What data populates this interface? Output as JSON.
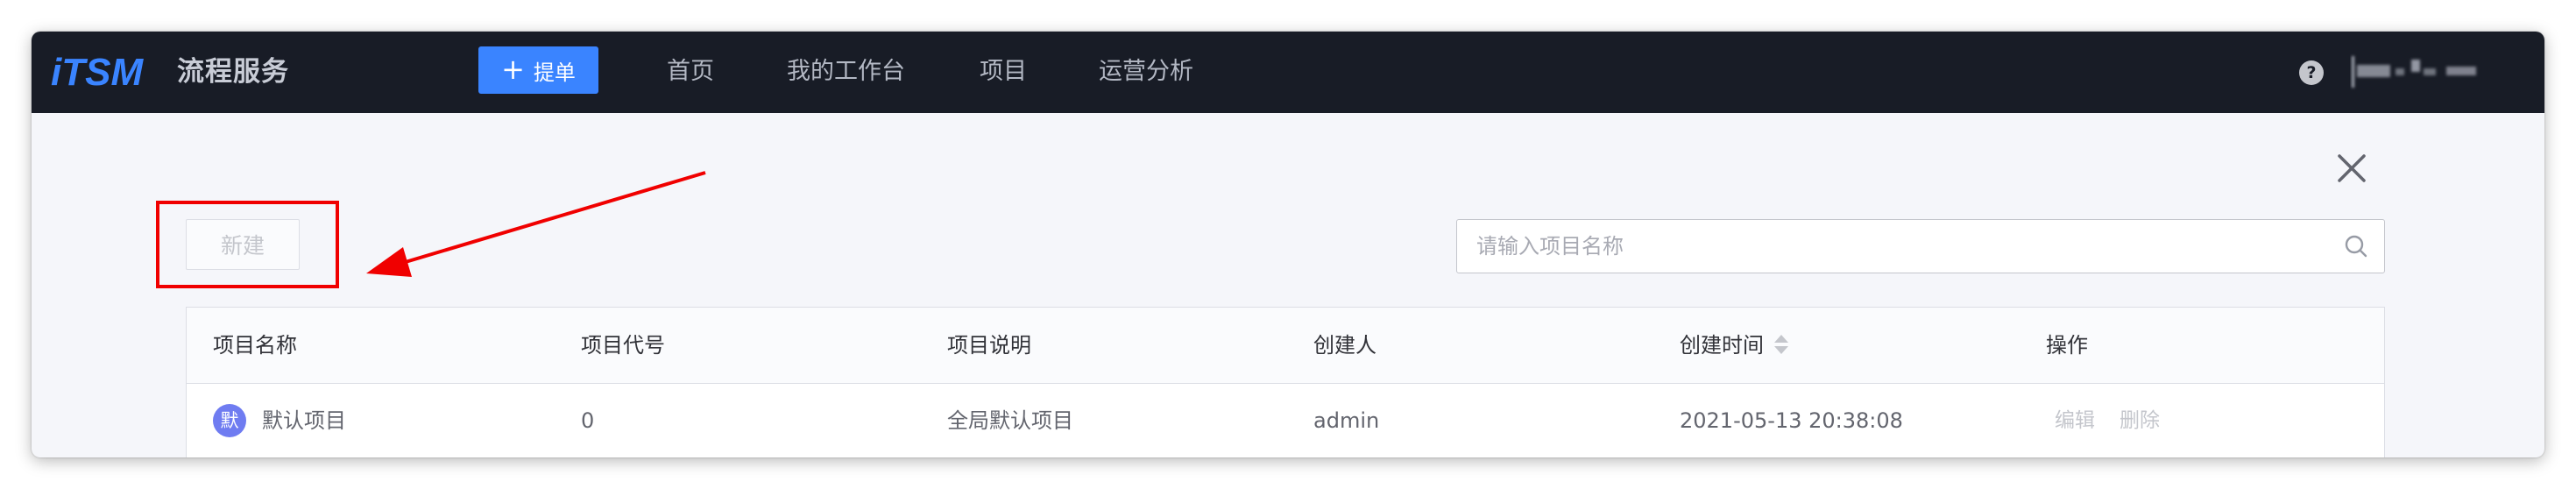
{
  "app": {
    "logo_text": "iTSM",
    "title": "流程服务",
    "submit_button": {
      "icon": "plus-icon",
      "label": "提单"
    },
    "nav": [
      "首页",
      "我的工作台",
      "项目",
      "运营分析"
    ],
    "help_icon": "question-icon",
    "help_glyph": "?"
  },
  "toolbar": {
    "new_button_label": "新建",
    "search_placeholder": "请输入项目名称",
    "search_value": ""
  },
  "table": {
    "headers": [
      "项目名称",
      "项目代号",
      "项目说明",
      "创建人",
      "创建时间",
      "操作"
    ],
    "rows": [
      {
        "avatar": "默",
        "name": "默认项目",
        "code": "0",
        "description": "全局默认项目",
        "creator": "admin",
        "created_at": "2021-05-13 20:38:08",
        "actions": [
          "编辑",
          "删除"
        ]
      }
    ]
  },
  "colors": {
    "topbar": "#181c26",
    "primary": "#3a84ff",
    "annotation": "#f00000",
    "avatar": "#6f7cf1"
  }
}
